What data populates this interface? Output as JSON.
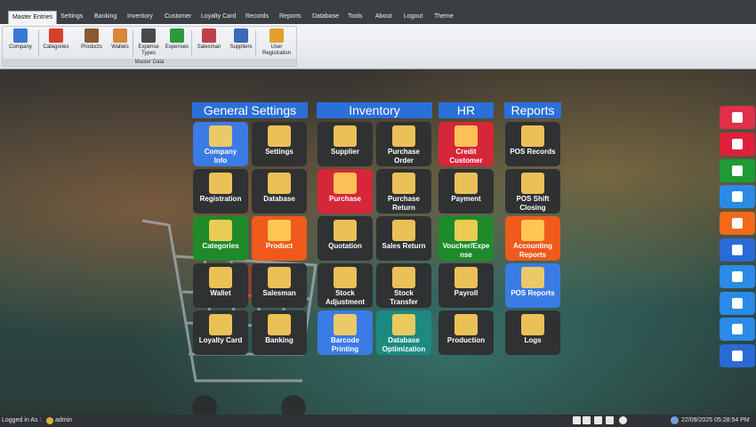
{
  "menu": [
    "Master Entries",
    "Settings",
    "Banking",
    "Inventory",
    "Customer",
    "Loyalty Card",
    "Records",
    "Reports",
    "Database",
    "Tools",
    "About",
    "Logout",
    "Theme"
  ],
  "ribbon": {
    "group_label": "Master Data",
    "buttons": [
      {
        "label": "Company",
        "icon": "company-icon",
        "color": "#3a78d6"
      },
      {
        "label": "Categories",
        "icon": "categories-icon",
        "color": "#d6402a"
      },
      {
        "label": "Products",
        "icon": "products-icon",
        "color": "#8a5a32"
      },
      {
        "label": "Wallets",
        "icon": "wallet-icon",
        "color": "#d8863a"
      },
      {
        "label": "Expense\nTypes",
        "icon": "expense-types-icon",
        "color": "#4a4a4a"
      },
      {
        "label": "Expenses",
        "icon": "expenses-icon",
        "color": "#2a9a3a"
      },
      {
        "label": "Salesman",
        "icon": "salesman-icon",
        "color": "#c0404a"
      },
      {
        "label": "Suppliers",
        "icon": "suppliers-icon",
        "color": "#3a6ab8"
      },
      {
        "label": "User\nRegistration",
        "icon": "user-registration-icon",
        "color": "#e0a030"
      }
    ]
  },
  "sections": {
    "general": "General Settings",
    "inventory": "Inventory",
    "hr": "HR",
    "reports": "Reports"
  },
  "tiles": {
    "general": [
      {
        "label": "Company\nInfo",
        "color": "blue",
        "icon": "company-info-icon"
      },
      {
        "label": "Settings",
        "color": "dark",
        "icon": "settings-gear-icon"
      },
      {
        "label": "Registration",
        "color": "dark",
        "icon": "registration-icon"
      },
      {
        "label": "Database",
        "color": "dark",
        "icon": "database-icon"
      },
      {
        "label": "Categories",
        "color": "green",
        "icon": "categories-icon"
      },
      {
        "label": "Product",
        "color": "orange",
        "icon": "product-icon"
      },
      {
        "label": "Wallet",
        "color": "dark",
        "icon": "wallet-icon"
      },
      {
        "label": "Salesman",
        "color": "dark",
        "icon": "salesman-icon"
      },
      {
        "label": "Loyalty Card",
        "color": "dark",
        "icon": "loyalty-card-icon"
      },
      {
        "label": "Banking",
        "color": "dark",
        "icon": "bank-icon"
      }
    ],
    "inventory": [
      {
        "label": "Supplier",
        "color": "dark",
        "icon": "supplier-icon"
      },
      {
        "label": "Purchase\nOrder",
        "color": "dark",
        "icon": "purchase-order-icon"
      },
      {
        "label": "Purchase",
        "color": "red",
        "icon": "purchase-icon"
      },
      {
        "label": "Purchase\nReturn",
        "color": "dark",
        "icon": "purchase-return-icon"
      },
      {
        "label": "Quotation",
        "color": "dark",
        "icon": "quotation-icon"
      },
      {
        "label": "Sales Return",
        "color": "dark",
        "icon": "sales-return-icon"
      },
      {
        "label": "Stock\nAdjustment",
        "color": "dark",
        "icon": "stock-adjustment-icon"
      },
      {
        "label": "Stock\nTransfer",
        "color": "dark",
        "icon": "stock-transfer-icon"
      },
      {
        "label": "Barcode\nPrinting",
        "color": "blue",
        "icon": "barcode-printer-icon"
      },
      {
        "label": "Database\nOptimization",
        "color": "teal",
        "icon": "database-optimization-icon"
      }
    ],
    "hr": [
      {
        "label": "Credit\nCustomer",
        "color": "red",
        "icon": "credit-customer-icon"
      },
      {
        "label": "Payment",
        "color": "dark",
        "icon": "payment-icon"
      },
      {
        "label": "Voucher/Expe\nnse",
        "color": "green",
        "icon": "voucher-icon"
      },
      {
        "label": "Payroll",
        "color": "dark",
        "icon": "payroll-icon"
      },
      {
        "label": "Production",
        "color": "dark",
        "icon": "production-icon"
      }
    ],
    "reports": [
      {
        "label": "POS Records",
        "color": "dark",
        "icon": "pos-records-icon"
      },
      {
        "label": "POS Shift\nClosing",
        "color": "dark",
        "icon": "pos-shift-closing-icon"
      },
      {
        "label": "Accounting\nReports",
        "color": "orange",
        "icon": "accounting-reports-icon"
      },
      {
        "label": "POS Reports",
        "color": "blue",
        "icon": "pos-reports-icon"
      },
      {
        "label": "Logs",
        "color": "dark",
        "icon": "logs-icon"
      }
    ]
  },
  "side_buttons": [
    {
      "icon": "window-icon",
      "color": "#e0304a"
    },
    {
      "icon": "power-icon",
      "color": "#e0203a"
    },
    {
      "icon": "notepad-icon",
      "color": "#1f9a35"
    },
    {
      "icon": "calendar-icon",
      "color": "#2a8ae6"
    },
    {
      "icon": "calculator-icon",
      "color": "#f06a1a"
    },
    {
      "icon": "word-icon",
      "color": "#2a6ad6"
    },
    {
      "icon": "monitor-icon",
      "color": "#2a8ae6"
    },
    {
      "icon": "keyboard-icon",
      "color": "#2a8ae6"
    },
    {
      "icon": "remote-desktop-icon",
      "color": "#2a8ae6"
    },
    {
      "icon": "cash-register-icon",
      "color": "#2a6ad6"
    }
  ],
  "status": {
    "logged_in_label": "Logged in As :",
    "user": "admin",
    "datetime": "22/09/2025 05:28:54 PM"
  }
}
